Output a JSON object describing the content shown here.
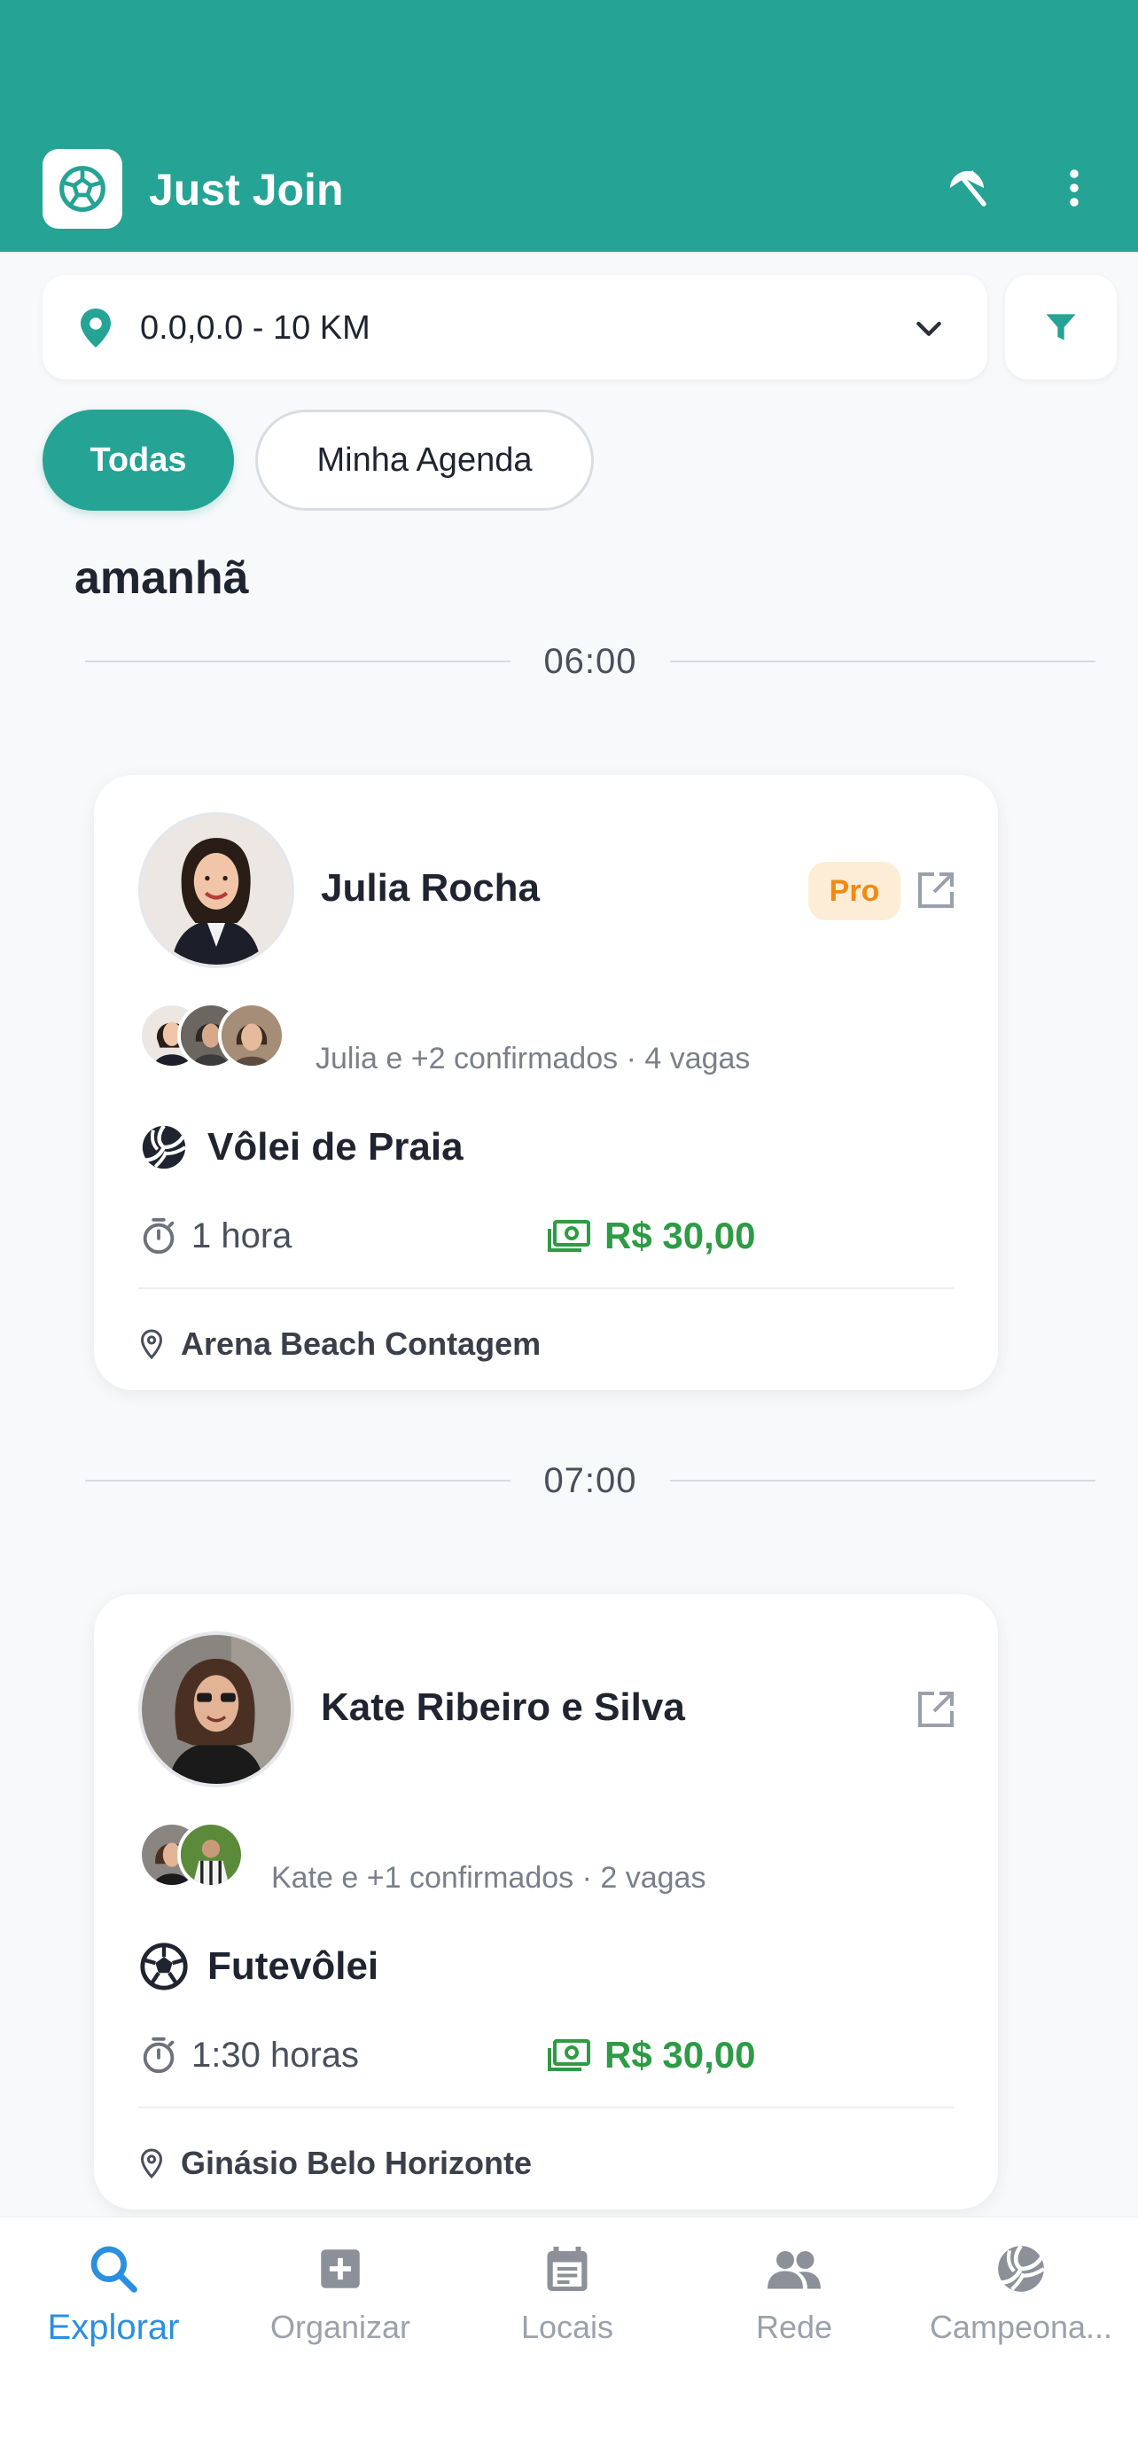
{
  "app": {
    "title": "Just Join",
    "brand_color": "#25a394"
  },
  "location": {
    "value": "0.0,0.0 - 10 KM",
    "icon": "location-pin-icon"
  },
  "filters": {
    "chips": [
      {
        "label": "Todas",
        "active": true
      },
      {
        "label": "Minha Agenda",
        "active": false
      }
    ]
  },
  "schedule": {
    "day_label": "amanhã",
    "groups": [
      {
        "time": "06:00",
        "event": {
          "organizer": "Julia Rocha",
          "badge": "Pro",
          "participants_text": "Julia e +2 confirmados · 4 vagas",
          "sport": "Vôlei de Praia",
          "sport_icon": "volleyball-icon",
          "duration": "1 hora",
          "price": "R$ 30,00",
          "place": "Arena Beach Contagem"
        }
      },
      {
        "time": "07:00",
        "event": {
          "organizer": "Kate Ribeiro e Silva",
          "participants_text": "Kate e +1 confirmados · 2 vagas",
          "sport": "Futevôlei",
          "sport_icon": "soccer-ball-icon",
          "duration": "1:30 horas",
          "price": "R$ 30,00",
          "place": "Ginásio Belo Horizonte"
        }
      }
    ]
  },
  "nav": {
    "items": [
      {
        "label": "Explorar",
        "icon": "search-icon",
        "active": true
      },
      {
        "label": "Organizar",
        "icon": "add-box-icon",
        "active": false
      },
      {
        "label": "Locais",
        "icon": "calendar-icon",
        "active": false
      },
      {
        "label": "Rede",
        "icon": "people-icon",
        "active": false
      },
      {
        "label": "Campeona...",
        "icon": "volleyball-icon",
        "active": false
      }
    ],
    "active_color": "#2b8fe0"
  },
  "colors": {
    "price": "#2e9b45",
    "pro_badge_bg": "#fdecd6",
    "pro_badge_text": "#f08a12"
  }
}
